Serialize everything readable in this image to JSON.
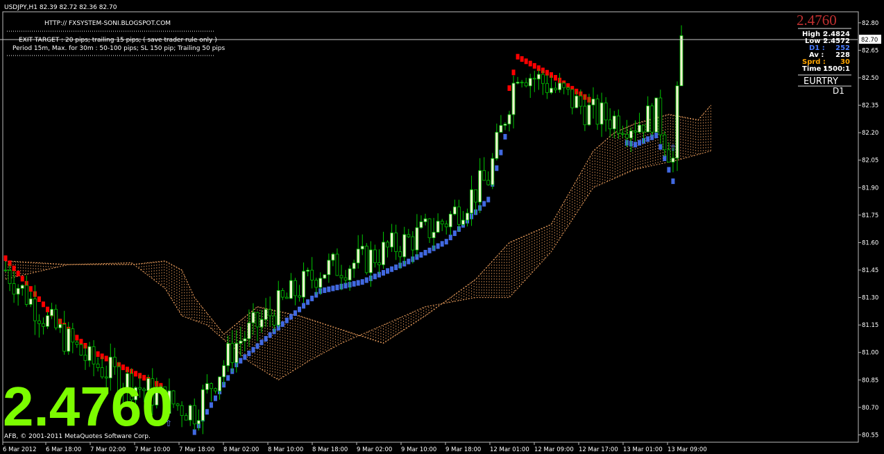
{
  "header": {
    "symbol_line": "USDJPY,H1  82.39 82.72 82.36 82.70",
    "site": "HTTP:// FXSYSTEM-SONI.BLOGSPOT.COM",
    "exit_target": "EXIT TARGET : 20 pips; trailing 15 pips; ( save trader rule only )",
    "period_line": "Period 15m, Max. for 30m  : 50-100 pips; SL 150 pip; Trailing 50 pips"
  },
  "footer": {
    "copyright": "AFB, © 2001-2011 MetaQuotes Software Corp."
  },
  "big_value": "2.4760",
  "panel": {
    "price": "2.4760",
    "high_label": "High :",
    "high_value": "2.4824",
    "low_label": "Low :",
    "low_value": "2.4572",
    "d1_label": "D1 :",
    "d1_value": "252",
    "av_label": "Av :",
    "av_value": "228",
    "sprd_label": "Sprd :",
    "sprd_value": "30",
    "time_label": "Time :",
    "time_value": "1500:1",
    "pair": "EURTRY",
    "tf": "D1"
  },
  "colors": {
    "background": "#000000",
    "bull": "#00c800",
    "bull_body": "#f0f0d0",
    "bear_body": "#000000",
    "up_trend": "#4169e1",
    "down_trend": "#ff0000",
    "cloud": "#f4a460",
    "big_value": "#7cfc00",
    "d1": "#4a7cff",
    "sprd": "#ffa500"
  },
  "chart_data": {
    "type": "candlestick",
    "symbol": "USDJPY",
    "timeframe": "H1",
    "last_price": 82.7,
    "ylim": [
      80.51,
      82.86
    ],
    "y_ticks": [
      "82.80",
      "82.65",
      "82.50",
      "82.35",
      "82.20",
      "82.05",
      "81.90",
      "81.75",
      "81.60",
      "81.45",
      "81.30",
      "81.15",
      "81.00",
      "80.85",
      "80.70",
      "80.55"
    ],
    "x_labels": [
      "6 Mar 2012",
      "6 Mar 18:00",
      "7 Mar 02:00",
      "7 Mar 10:00",
      "7 Mar 18:00",
      "8 Mar 02:00",
      "8 Mar 10:00",
      "8 Mar 18:00",
      "9 Mar 02:00",
      "9 Mar 10:00",
      "9 Mar 18:00",
      "12 Mar 01:00",
      "12 Mar 09:00",
      "12 Mar 17:00",
      "13 Mar 01:00",
      "13 Mar 09:00"
    ],
    "candle_count": 162,
    "keypoints": [
      [
        0,
        81.45
      ],
      [
        10,
        81.17
      ],
      [
        20,
        80.95
      ],
      [
        30,
        80.83
      ],
      [
        40,
        80.72
      ],
      [
        45,
        80.68
      ],
      [
        55,
        81.05
      ],
      [
        65,
        81.25
      ],
      [
        75,
        81.45
      ],
      [
        85,
        81.5
      ],
      [
        95,
        81.6
      ],
      [
        105,
        81.72
      ],
      [
        115,
        81.95
      ],
      [
        122,
        82.55
      ],
      [
        130,
        82.45
      ],
      [
        140,
        82.3
      ],
      [
        150,
        82.25
      ],
      [
        155,
        82.3
      ],
      [
        159,
        82.05
      ],
      [
        161,
        82.7
      ]
    ],
    "cloud_top": [
      [
        0,
        81.5
      ],
      [
        15,
        81.48
      ],
      [
        30,
        81.48
      ],
      [
        38,
        81.5
      ],
      [
        42,
        81.45
      ],
      [
        45,
        81.3
      ],
      [
        52,
        81.1
      ],
      [
        60,
        81.25
      ],
      [
        70,
        81.2
      ],
      [
        90,
        81.05
      ],
      [
        100,
        81.2
      ],
      [
        112,
        81.4
      ],
      [
        120,
        81.6
      ],
      [
        130,
        81.7
      ],
      [
        135,
        81.9
      ],
      [
        140,
        82.1
      ],
      [
        145,
        82.2
      ],
      [
        150,
        82.25
      ],
      [
        158,
        82.3
      ],
      [
        165,
        82.27
      ],
      [
        168,
        82.35
      ]
    ],
    "cloud_bottom": [
      [
        0,
        81.4
      ],
      [
        15,
        81.48
      ],
      [
        30,
        81.49
      ],
      [
        38,
        81.35
      ],
      [
        42,
        81.2
      ],
      [
        48,
        81.15
      ],
      [
        58,
        80.95
      ],
      [
        65,
        80.85
      ],
      [
        72,
        80.95
      ],
      [
        80,
        81.05
      ],
      [
        90,
        81.15
      ],
      [
        100,
        81.25
      ],
      [
        112,
        81.3
      ],
      [
        120,
        81.3
      ],
      [
        130,
        81.55
      ],
      [
        140,
        81.9
      ],
      [
        150,
        82.0
      ],
      [
        160,
        82.05
      ],
      [
        168,
        82.1
      ]
    ]
  }
}
